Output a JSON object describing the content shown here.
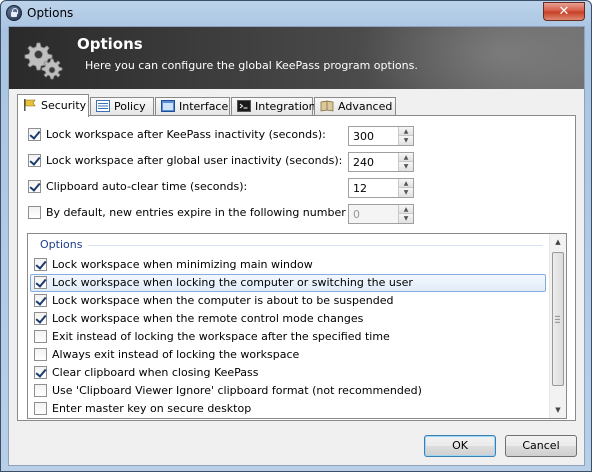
{
  "window": {
    "title": "Options",
    "close_label": "✕"
  },
  "banner": {
    "title": "Options",
    "description": "Here you can configure the global KeePass program options."
  },
  "tabs": [
    {
      "label": "Security",
      "icon": "security-flag-icon"
    },
    {
      "label": "Policy",
      "icon": "policy-list-icon"
    },
    {
      "label": "Interface",
      "icon": "interface-window-icon"
    },
    {
      "label": "Integration",
      "icon": "integration-console-icon"
    },
    {
      "label": "Advanced",
      "icon": "advanced-book-icon"
    }
  ],
  "settings": [
    {
      "label": "Lock workspace after KeePass inactivity (seconds):",
      "checked": true,
      "value": "300",
      "enabled": true
    },
    {
      "label": "Lock workspace after global user inactivity (seconds):",
      "checked": true,
      "value": "240",
      "enabled": true
    },
    {
      "label": "Clipboard auto-clear time (seconds):",
      "checked": true,
      "value": "12",
      "enabled": true
    },
    {
      "label": "By default, new entries expire in the following number of days:",
      "checked": false,
      "value": "0",
      "enabled": false
    }
  ],
  "options": {
    "header": "Options",
    "items": [
      {
        "label": "Lock workspace when minimizing main window",
        "checked": true,
        "selected": false
      },
      {
        "label": "Lock workspace when locking the computer or switching the user",
        "checked": true,
        "selected": true
      },
      {
        "label": "Lock workspace when the computer is about to be suspended",
        "checked": true,
        "selected": false
      },
      {
        "label": "Lock workspace when the remote control mode changes",
        "checked": true,
        "selected": false
      },
      {
        "label": "Exit instead of locking the workspace after the specified time",
        "checked": false,
        "selected": false
      },
      {
        "label": "Always exit instead of locking the workspace",
        "checked": false,
        "selected": false
      },
      {
        "label": "Clear clipboard when closing KeePass",
        "checked": true,
        "selected": false
      },
      {
        "label": "Use 'Clipboard Viewer Ignore' clipboard format (not recommended)",
        "checked": false,
        "selected": false
      },
      {
        "label": "Enter master key on secure desktop",
        "checked": false,
        "selected": false
      }
    ]
  },
  "buttons": {
    "ok": "OK",
    "cancel": "Cancel"
  }
}
